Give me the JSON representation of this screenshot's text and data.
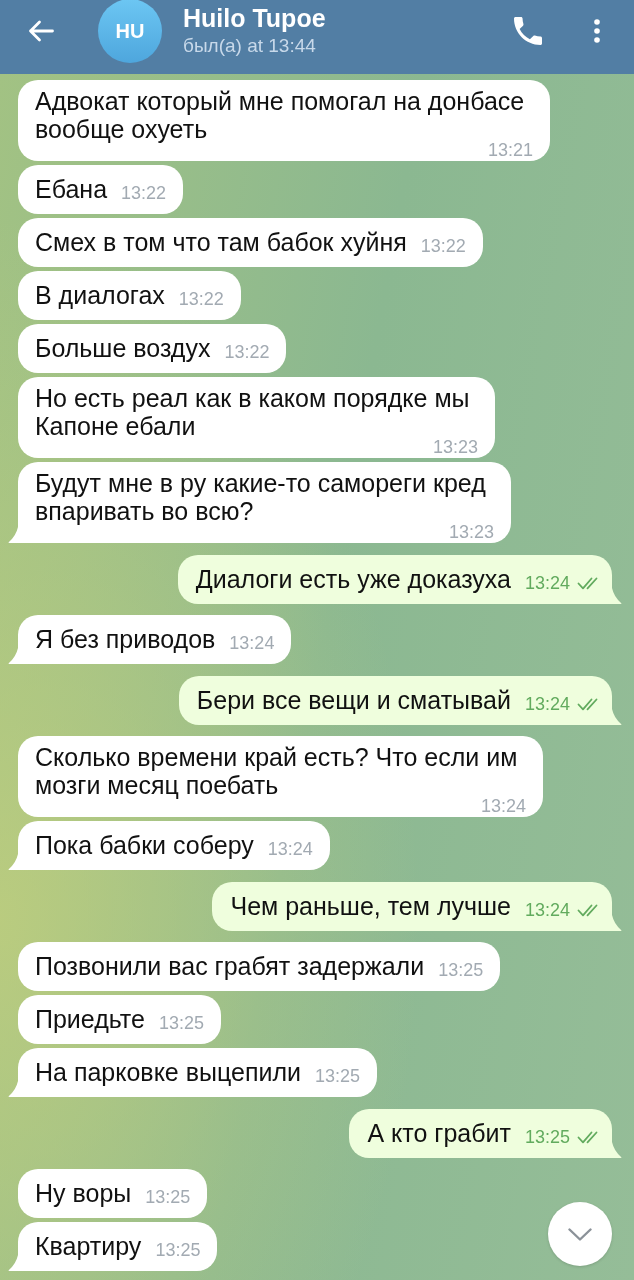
{
  "header": {
    "avatar": "HU",
    "title": "Huilo Tupoe",
    "status": "был(а) at 13:44"
  },
  "messages": [
    {
      "kind": "incoming",
      "text": "Адвокат который мне помогал на донбасе вообще охуеть",
      "time": "13:21"
    },
    {
      "kind": "incoming",
      "text": "Ебана",
      "time": "13:22"
    },
    {
      "kind": "incoming",
      "text": "Смех в том что там бабок хуйня",
      "time": "13:22"
    },
    {
      "kind": "incoming",
      "text": "В диалогах",
      "time": "13:22"
    },
    {
      "kind": "incoming",
      "text": "Больше воздух",
      "time": "13:22"
    },
    {
      "kind": "incoming",
      "text": "Но есть реал как в каком порядке мы Капоне ебали",
      "time": "13:23"
    },
    {
      "kind": "incoming",
      "text": "Будут мне в ру какие-то самореги кред впаривать во всю?",
      "time": "13:23"
    },
    {
      "kind": "outgoing",
      "text": "Диалоги есть уже доказуха",
      "time": "13:24",
      "read": true
    },
    {
      "kind": "incoming",
      "text": "Я без приводов",
      "time": "13:24"
    },
    {
      "kind": "outgoing",
      "text": "Бери все вещи и сматывай",
      "time": "13:24",
      "read": true
    },
    {
      "kind": "incoming",
      "text": "Сколько времени край есть? Что если им мозги месяц поебать",
      "time": "13:24"
    },
    {
      "kind": "incoming",
      "text": "Пока бабки соберу",
      "time": "13:24"
    },
    {
      "kind": "outgoing",
      "text": "Чем раньше, тем лучше",
      "time": "13:24",
      "read": true
    },
    {
      "kind": "incoming",
      "text": "Позвонили вас грабят задержали",
      "time": "13:25"
    },
    {
      "kind": "incoming",
      "text": "Приедьте",
      "time": "13:25"
    },
    {
      "kind": "incoming",
      "text": "На парковке выцепили",
      "time": "13:25"
    },
    {
      "kind": "outgoing",
      "text": "А кто грабит",
      "time": "13:25",
      "read": true
    },
    {
      "kind": "incoming",
      "text": "Ну воры",
      "time": "13:25"
    },
    {
      "kind": "incoming",
      "text": "Квартиру",
      "time": "13:25"
    }
  ]
}
